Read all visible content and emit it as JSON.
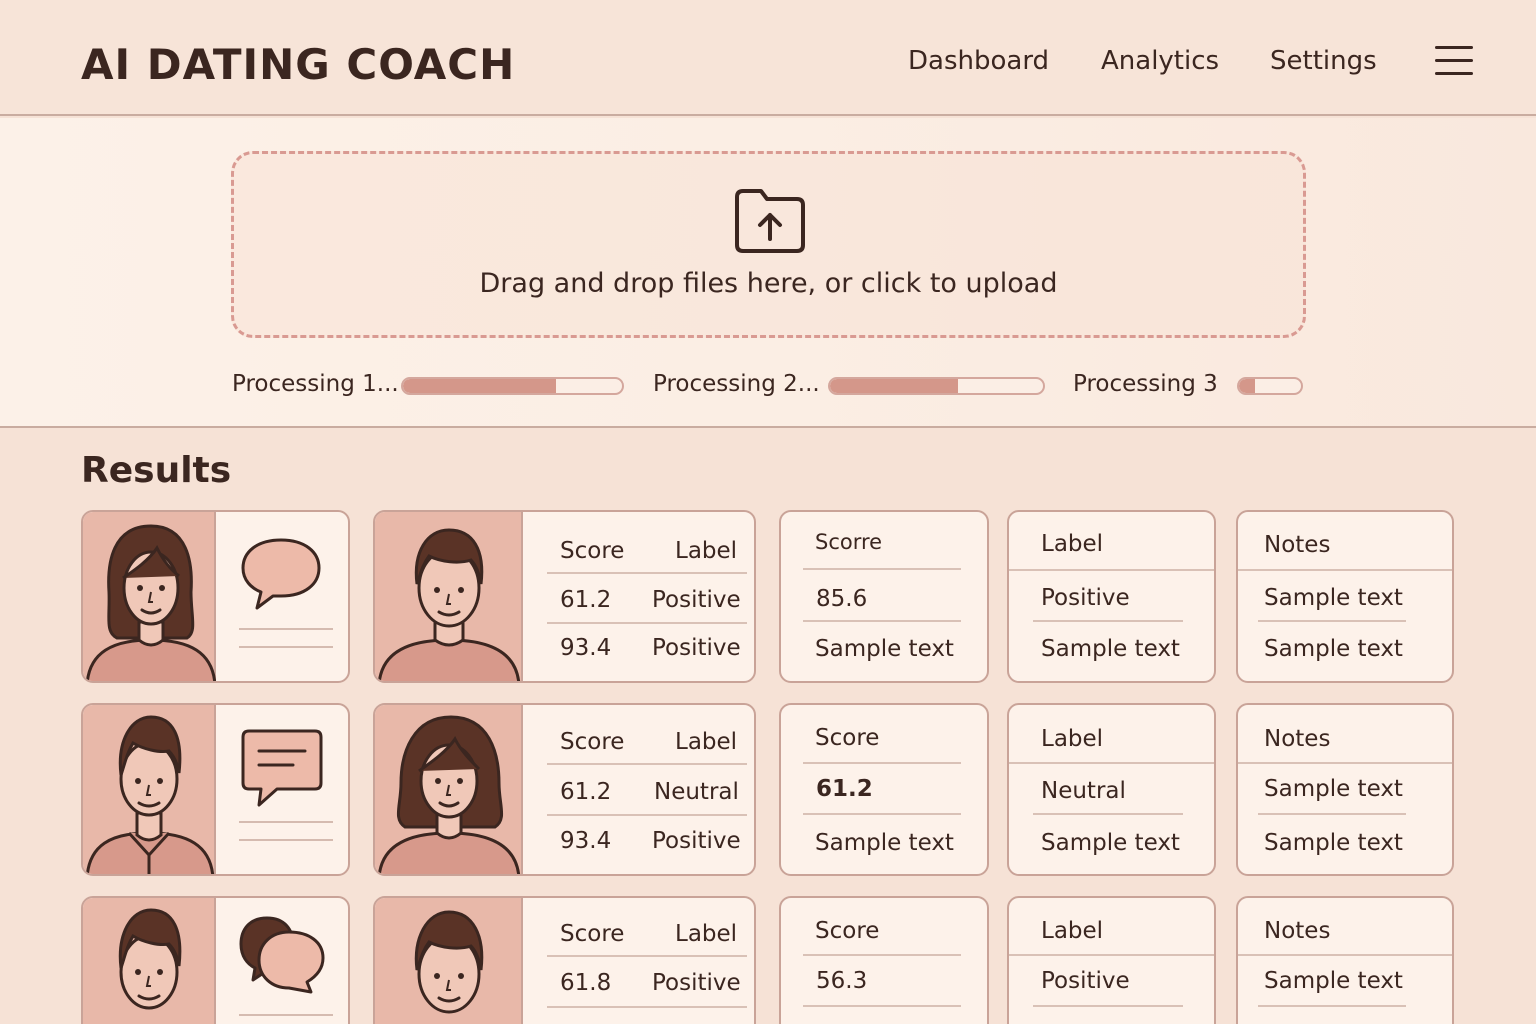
{
  "header": {
    "title": "AI DATING COACH",
    "nav": [
      "Dashboard",
      "Analytics",
      "Settings"
    ],
    "menu_icon": "hamburger-menu-icon"
  },
  "upload": {
    "icon": "folder-upload-icon",
    "text": "Drag and drop files here, or click to upload",
    "progress": [
      {
        "label": "Processing 1...",
        "percent": 70
      },
      {
        "label": "Processing 2...",
        "percent": 60
      },
      {
        "label": "Processing 3",
        "percent": 25
      }
    ]
  },
  "results": {
    "title": "Results",
    "rows": [
      {
        "chat_icon": "speech-bubble-icon",
        "table": {
          "head": [
            "Score",
            "Label"
          ],
          "rows": [
            [
              "61.2",
              "Positive"
            ],
            [
              "93.4",
              "Positive"
            ]
          ]
        },
        "score_card": {
          "head": "Scorre",
          "value": "85.6",
          "text": "Sample text"
        },
        "label_card": {
          "head": "Label",
          "value": "Positive",
          "text": "Sample text"
        },
        "notes_card": {
          "head": "Notes",
          "value": "Sample text",
          "text": "Sample text"
        }
      },
      {
        "chat_icon": "message-bubble-icon",
        "table": {
          "head": [
            "Score",
            "Label"
          ],
          "rows": [
            [
              "61.2",
              "Neutral"
            ],
            [
              "93.4",
              "Positive"
            ]
          ]
        },
        "score_card": {
          "head": "Score",
          "value": "61.2",
          "text": "Sample text"
        },
        "label_card": {
          "head": "Label",
          "value": "Neutral",
          "text": "Sample text"
        },
        "notes_card": {
          "head": "Notes",
          "value": "Sample text",
          "text": "Sample text"
        }
      },
      {
        "chat_icon": "double-bubble-icon",
        "table": {
          "head": [
            "Score",
            "Label"
          ],
          "rows": [
            [
              "61.8",
              "Positive"
            ]
          ]
        },
        "score_card": {
          "head": "Score",
          "value": "56.3"
        },
        "label_card": {
          "head": "Label",
          "value": "Positive"
        },
        "notes_card": {
          "head": "Notes",
          "value": "Sample text"
        }
      }
    ]
  },
  "colors": {
    "background": "#f6e2d6",
    "accent": "#d4978a",
    "avatar_bg": "#e8b8a9",
    "text": "#3b2620",
    "border": "#c9a398"
  }
}
